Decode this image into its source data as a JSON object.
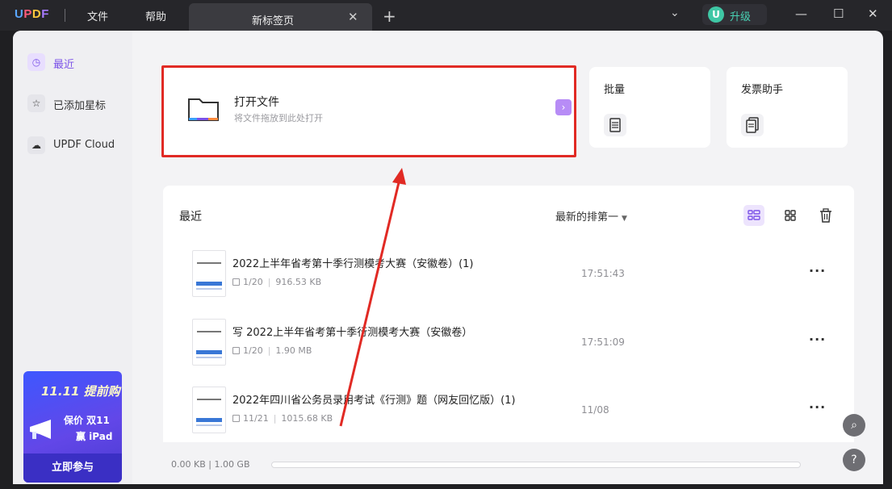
{
  "titlebar": {
    "logo": "UPDF",
    "menu": [
      "文件",
      "帮助"
    ],
    "tab_label": "新标签页",
    "tab_close": "✕",
    "new_tab": "+",
    "dropdown": "⌄",
    "upgrade_initial": "U",
    "upgrade_label": "升级",
    "minimize": "—",
    "maximize": "☐",
    "close": "✕"
  },
  "sidebar": {
    "items": [
      {
        "label": "最近",
        "icon": "clock-icon",
        "glyph": "◷"
      },
      {
        "label": "已添加星标",
        "icon": "star-icon",
        "glyph": "☆"
      },
      {
        "label": "UPDF Cloud",
        "icon": "cloud-icon",
        "glyph": "☁"
      }
    ],
    "promo": {
      "headline": "11.11 提前购",
      "line1": "保价 双11",
      "line2": "赢 iPad",
      "cta": "立即参与"
    }
  },
  "open_file": {
    "title": "打开文件",
    "subtitle": "将文件拖放到此处打开",
    "go_glyph": "›"
  },
  "quick_cards": [
    {
      "title": "批量",
      "icon": "batch-icon"
    },
    {
      "title": "发票助手",
      "icon": "invoice-icon"
    }
  ],
  "recent": {
    "title": "最近",
    "sort_label": "最新的排第一",
    "sort_caret": "▼",
    "files": [
      {
        "name": "2022上半年省考第十季行测模考大赛（安徽卷）(1)",
        "pages": "1/20",
        "size": "916.53 KB",
        "time": "17:51:43",
        "more": "···"
      },
      {
        "name": "写 2022上半年省考第十季行测模考大赛（安徽卷）",
        "pages": "1/20",
        "size": "1.90 MB",
        "time": "17:51:09",
        "more": "···"
      },
      {
        "name": "2022年四川省公务员录用考试《行测》题（网友回忆版）(1)",
        "pages": "11/21",
        "size": "1015.68 KB",
        "time": "11/08",
        "more": "···"
      }
    ]
  },
  "footer": {
    "storage": "0.00 KB | 1.00 GB",
    "search_glyph": "⌕",
    "help_glyph": "?"
  },
  "colors": {
    "accent": "#7b52e8",
    "highlight_red": "#e12a24",
    "upgrade_green": "#3fc7a5"
  }
}
